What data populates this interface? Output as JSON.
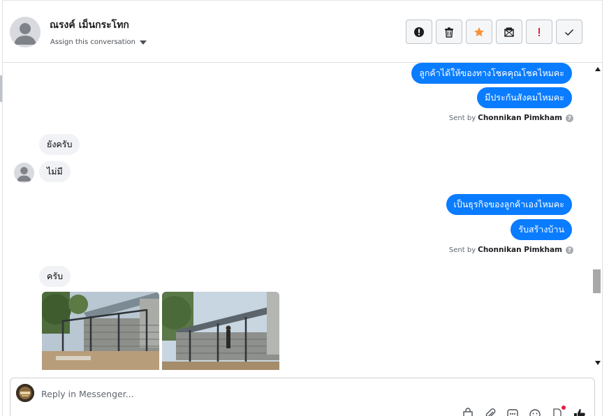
{
  "header": {
    "contact_name": "ณรงค์ เม็นกระโทก",
    "assign_label": "Assign this conversation",
    "actions": [
      {
        "icon": "alert-circle-icon"
      },
      {
        "icon": "trash-icon"
      },
      {
        "icon": "star-icon",
        "color": "#f7923b"
      },
      {
        "icon": "mail-unread-icon"
      },
      {
        "icon": "exclamation-icon",
        "color": "#e41e3f"
      },
      {
        "icon": "checkmark-icon"
      }
    ]
  },
  "conversation": {
    "groups": [
      {
        "direction": "outgoing",
        "messages": [
          "ลูกค้าได้ให้ของทางโชคคุณโชคไหมคะ",
          "มีประกันสังคมไหมคะ"
        ],
        "sent_by_prefix": "Sent by",
        "sent_by_name": "Chonnikan Pimkham"
      },
      {
        "direction": "incoming",
        "messages": [
          "ยังครับ",
          "ไม่มี"
        ]
      },
      {
        "direction": "outgoing",
        "messages": [
          "เป็นธุรกิจของลูกค้าเองไหมคะ",
          "รับสร้างบ้าน"
        ],
        "sent_by_prefix": "Sent by",
        "sent_by_name": "Chonnikan Pimkham"
      },
      {
        "direction": "incoming",
        "messages": [
          "ครับ"
        ],
        "attachments": [
          "photo",
          "photo"
        ]
      }
    ]
  },
  "reply": {
    "placeholder": "Reply in Messenger..."
  },
  "colors": {
    "outgoing_bubble": "#0a7cff",
    "incoming_bubble": "#f0f2f5",
    "star": "#f7923b",
    "alert": "#e41e3f"
  }
}
